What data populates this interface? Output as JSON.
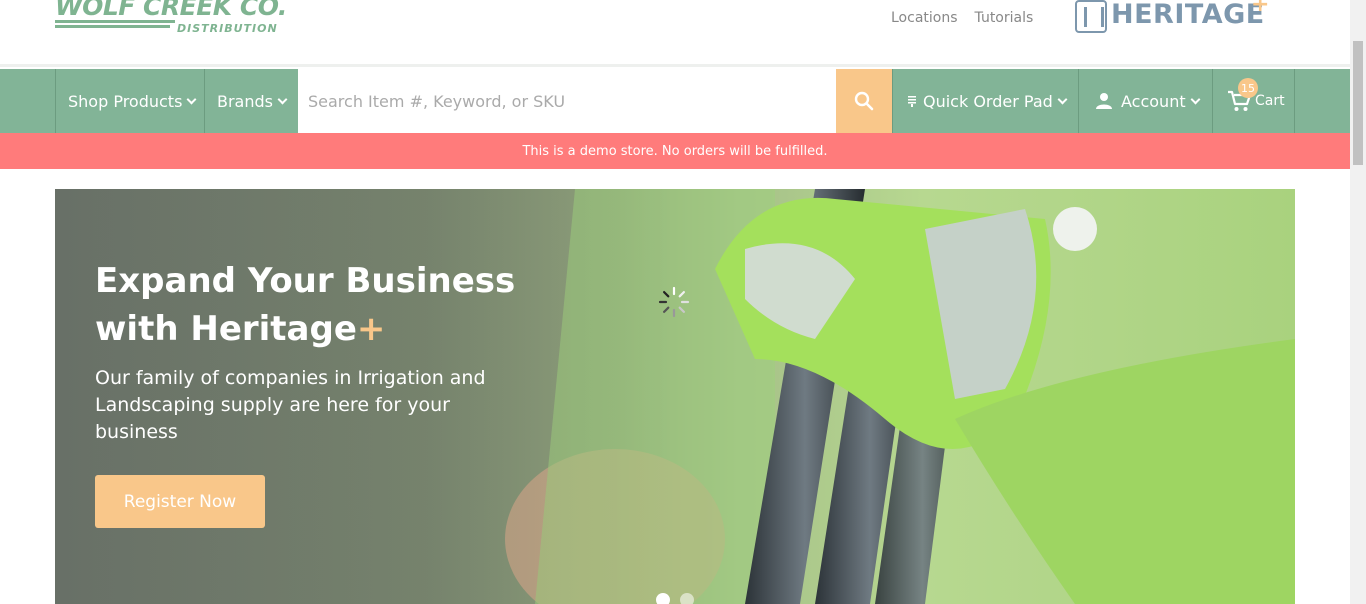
{
  "header": {
    "logo_text": "WOLF CREEK CO.",
    "logo_subtext": "DISTRIBUTION",
    "links": [
      "Locations",
      "Tutorials"
    ],
    "partner_logo_text": "HERITAGE",
    "partner_logo_plus": "+"
  },
  "nav": {
    "shop_products": "Shop Products",
    "brands": "Brands",
    "search_placeholder": "Search Item #, Keyword, or SKU",
    "quick_order": "Quick Order Pad",
    "account": "Account",
    "cart_label": "Cart",
    "cart_count": "15"
  },
  "notice": {
    "text": "This is a demo store. No orders will be fulfilled."
  },
  "hero": {
    "title_line1": "Expand Your Business",
    "title_line2": "with Heritage",
    "title_plus": "+",
    "subtitle": "Our family of companies in Irrigation and Landscaping supply are here for your business",
    "cta": "Register Now",
    "slides_total": 2,
    "active_slide": 1
  },
  "colors": {
    "nav_green": "#82b497",
    "accent_orange": "#f9c78a",
    "notice_red": "#ff7b7b",
    "logo_green": "#7fb491",
    "partner_blue": "#7d97ad"
  }
}
